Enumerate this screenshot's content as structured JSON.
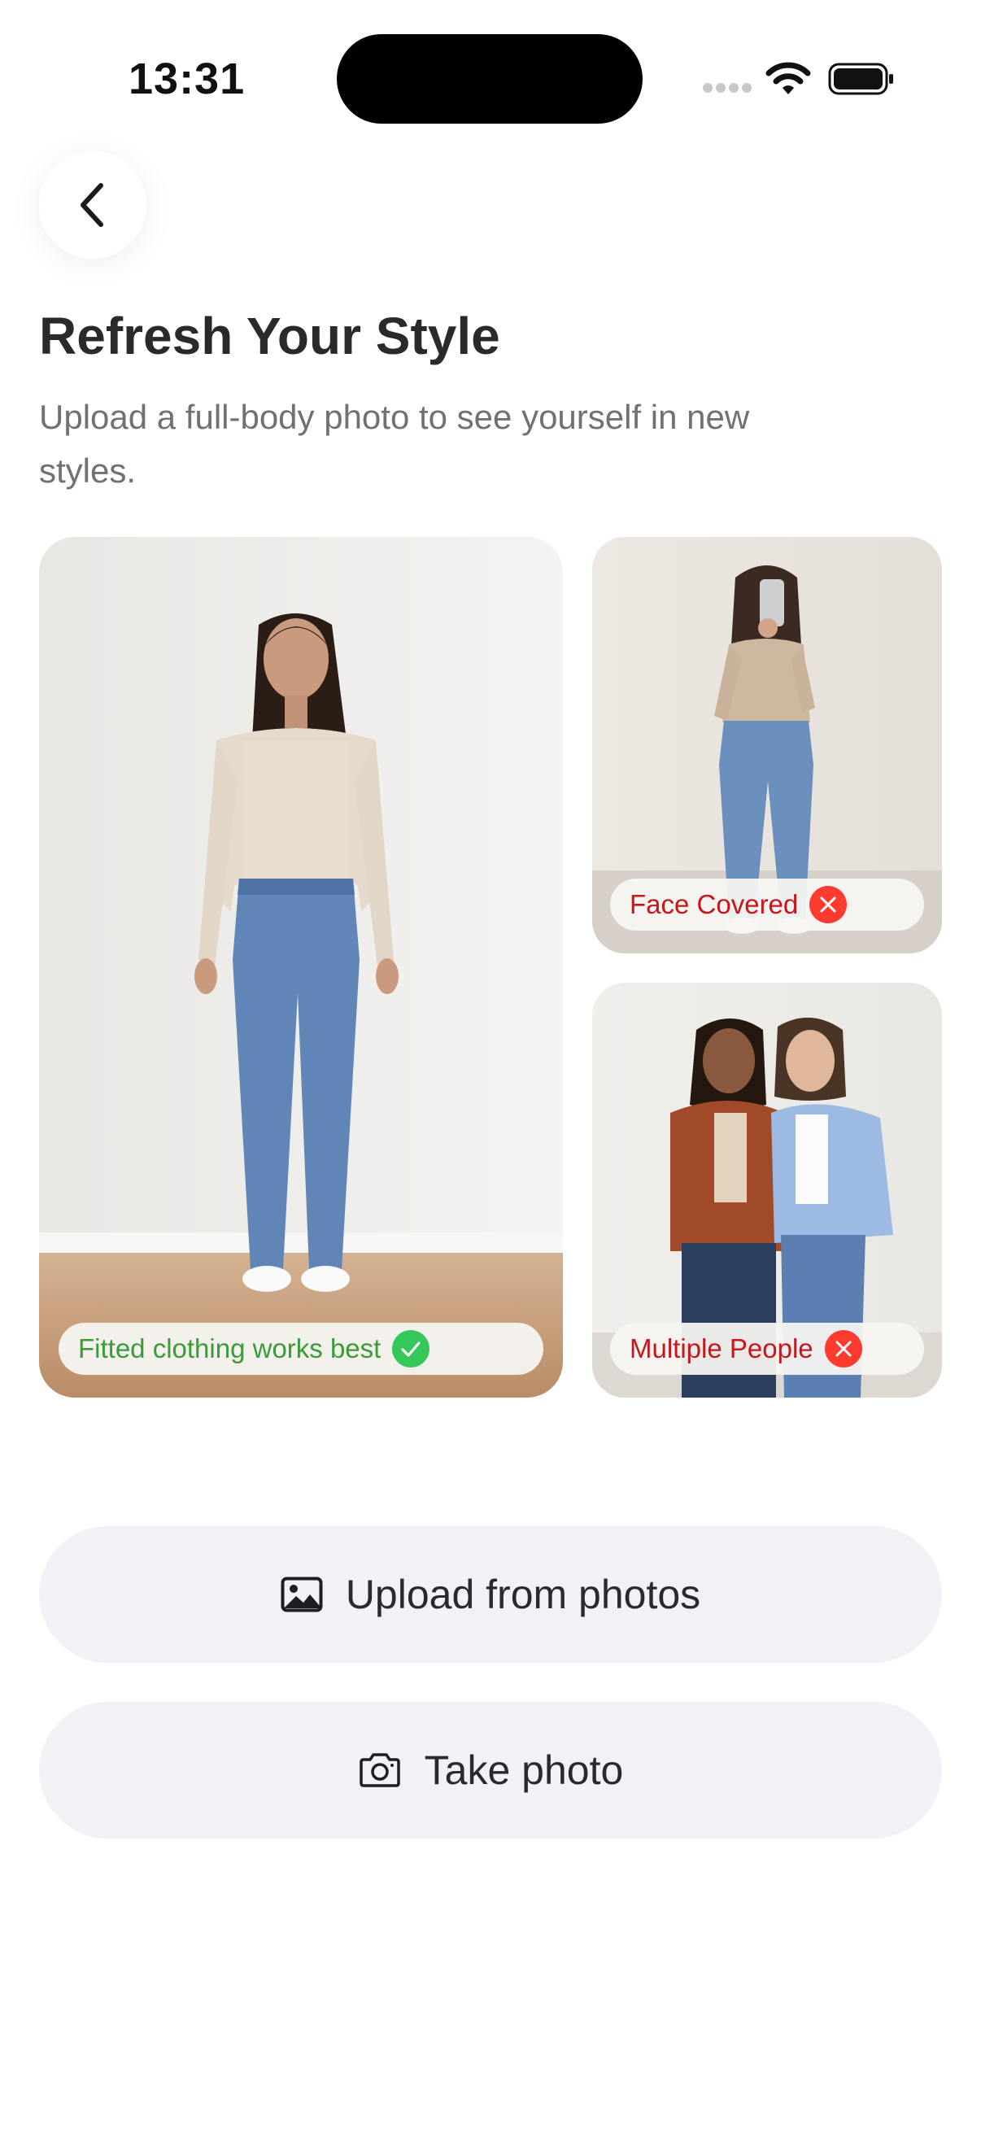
{
  "status_bar": {
    "time": "13:31"
  },
  "header": {
    "title": "Refresh Your Style",
    "subtitle": "Upload a full-body photo to see yourself in new styles."
  },
  "examples": [
    {
      "caption": "Fitted clothing works best",
      "status": "good"
    },
    {
      "caption": "Face Covered",
      "status": "bad"
    },
    {
      "caption": "Multiple People",
      "status": "bad"
    }
  ],
  "actions": {
    "upload": {
      "label": "Upload from photos",
      "icon": "image-icon"
    },
    "take": {
      "label": "Take photo",
      "icon": "camera-icon"
    }
  },
  "colors": {
    "good": "#34c759",
    "bad": "#ff3b30",
    "button_bg": "#f1f1f6"
  }
}
